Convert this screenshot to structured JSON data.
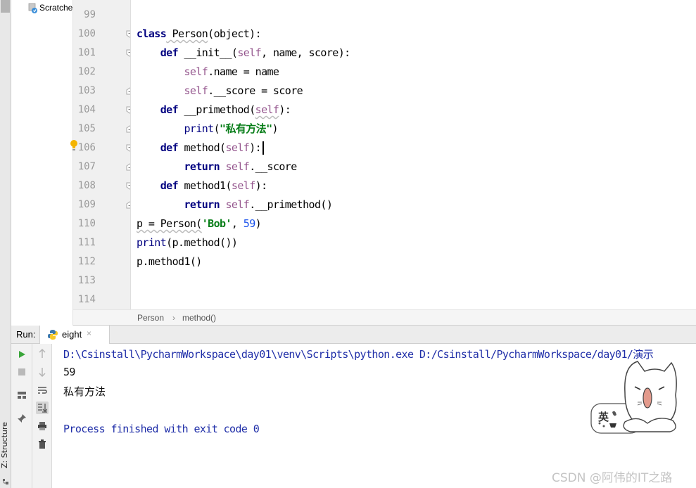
{
  "project": {
    "scratches_label": "Scratche"
  },
  "sidebar": {
    "structure_label": "Z: Structure"
  },
  "editor": {
    "line_numbers": [
      "99",
      "100",
      "101",
      "102",
      "103",
      "104",
      "105",
      "106",
      "107",
      "108",
      "109",
      "110",
      "111",
      "112",
      "113",
      "114"
    ],
    "lines": [
      {
        "no": "100",
        "parts": [
          {
            "t": "class",
            "c": "kw"
          },
          {
            "t": " Person",
            "c": "fn wavy"
          },
          {
            "t": "(object):",
            "c": ""
          }
        ]
      },
      {
        "no": "101",
        "parts": [
          {
            "t": "    "
          },
          {
            "t": "def",
            "c": "kw"
          },
          {
            "t": " __init__",
            "c": "fn"
          },
          {
            "t": "(",
            "c": ""
          },
          {
            "t": "self",
            "c": "self"
          },
          {
            "t": ", name, score):",
            "c": ""
          }
        ]
      },
      {
        "no": "102",
        "parts": [
          {
            "t": "        "
          },
          {
            "t": "self",
            "c": "self"
          },
          {
            "t": ".name = name",
            "c": ""
          }
        ]
      },
      {
        "no": "103",
        "parts": [
          {
            "t": "        "
          },
          {
            "t": "self",
            "c": "self"
          },
          {
            "t": ".__score = score",
            "c": ""
          }
        ]
      },
      {
        "no": "104",
        "parts": [
          {
            "t": "    "
          },
          {
            "t": "def",
            "c": "kw"
          },
          {
            "t": " __primethod",
            "c": "fn"
          },
          {
            "t": "(",
            "c": ""
          },
          {
            "t": "self",
            "c": "self wavy"
          },
          {
            "t": "):",
            "c": ""
          }
        ]
      },
      {
        "no": "105",
        "parts": [
          {
            "t": "        "
          },
          {
            "t": "print",
            "c": "kw-fn"
          },
          {
            "t": "(",
            "c": ""
          },
          {
            "t": "\"私有方法\"",
            "c": "str"
          },
          {
            "t": ")",
            "c": ""
          }
        ]
      },
      {
        "no": "106",
        "parts": [
          {
            "t": "    "
          },
          {
            "t": "def",
            "c": "kw"
          },
          {
            "t": " method",
            "c": "fn"
          },
          {
            "t": "(",
            "c": ""
          },
          {
            "t": "self",
            "c": "self"
          },
          {
            "t": "):",
            "c": ""
          }
        ]
      },
      {
        "no": "107",
        "parts": [
          {
            "t": "        "
          },
          {
            "t": "return",
            "c": "kw"
          },
          {
            "t": " ",
            "c": ""
          },
          {
            "t": "self",
            "c": "self"
          },
          {
            "t": ".__score",
            "c": ""
          }
        ]
      },
      {
        "no": "108",
        "parts": [
          {
            "t": "    "
          },
          {
            "t": "def",
            "c": "kw"
          },
          {
            "t": " method1",
            "c": "fn"
          },
          {
            "t": "(",
            "c": ""
          },
          {
            "t": "self",
            "c": "self"
          },
          {
            "t": "):",
            "c": ""
          }
        ]
      },
      {
        "no": "109",
        "parts": [
          {
            "t": "        "
          },
          {
            "t": "return",
            "c": "kw"
          },
          {
            "t": " ",
            "c": ""
          },
          {
            "t": "self",
            "c": "self"
          },
          {
            "t": ".__primethod()",
            "c": ""
          }
        ]
      },
      {
        "no": "110",
        "parts": [
          {
            "t": "p = Person(",
            "c": "wavy"
          },
          {
            "t": "'Bob'",
            "c": "str"
          },
          {
            "t": ", ",
            "c": ""
          },
          {
            "t": "59",
            "c": "num"
          },
          {
            "t": ")",
            "c": ""
          }
        ]
      },
      {
        "no": "111",
        "parts": [
          {
            "t": "print",
            "c": "kw-fn"
          },
          {
            "t": "(p.method())",
            "c": ""
          }
        ]
      },
      {
        "no": "112",
        "parts": [
          {
            "t": "p.method1()",
            "c": ""
          }
        ]
      }
    ],
    "current_line": "106"
  },
  "breadcrumb": {
    "class_name": "Person",
    "separator": "›",
    "method_name": "method()"
  },
  "run": {
    "label": "Run:",
    "tab_name": "eight",
    "tab_close": "×",
    "console": {
      "command": "D:\\Csinstall\\PycharmWorkspace\\day01\\venv\\Scripts\\python.exe D:/Csinstall/PycharmWorkspace/day01/演示",
      "out1": "59",
      "out2": "私有方法",
      "exit": "Process finished with exit code 0"
    }
  },
  "sticker": {
    "char": "英"
  },
  "watermark": "CSDN @阿伟的IT之路",
  "colors": {
    "keyword": "#000080",
    "self": "#94558d",
    "string": "#067d17",
    "number": "#1750eb",
    "console_blue": "#1f2ea8",
    "current_line": "#fcfaed"
  }
}
